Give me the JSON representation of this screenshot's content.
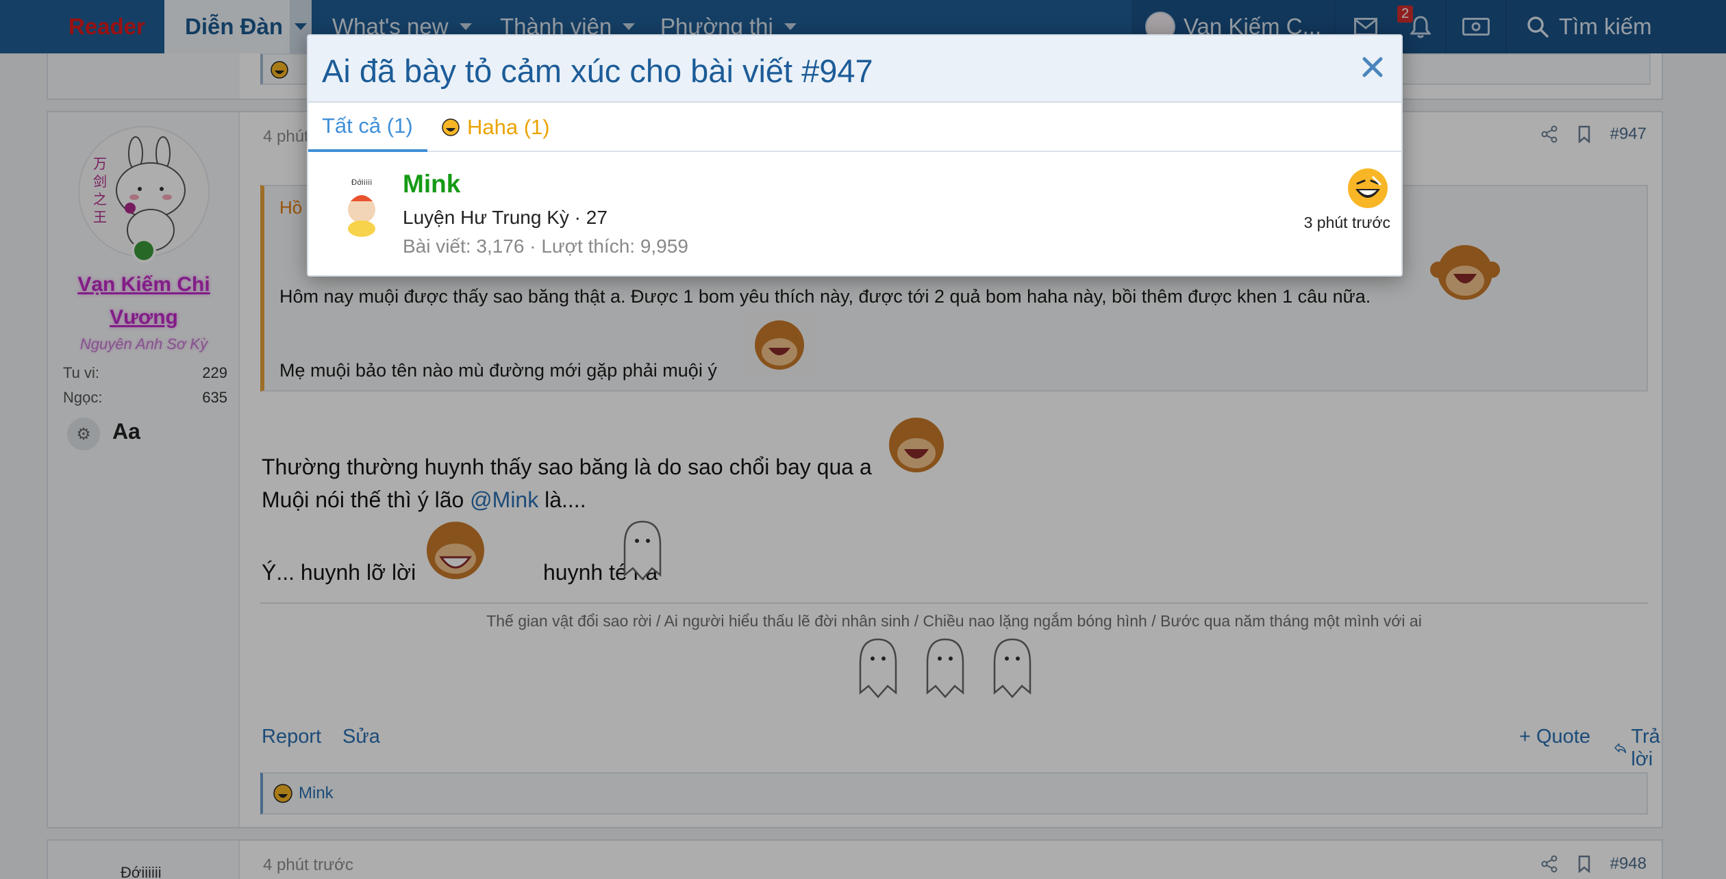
{
  "nav": {
    "reader": "Reader",
    "forum": "Diễn Đàn",
    "whats_new": "What's new",
    "members": "Thành viên",
    "arena": "Phường thị",
    "user_name": "Van Kiếm C...",
    "alerts_count": "2",
    "search_label": "Tìm kiếm"
  },
  "post": {
    "time": "4 phút",
    "number": "#947",
    "author": {
      "name_line1": "Vạn Kiếm Chi",
      "name_line2": "Vương",
      "title": "Nguyên Anh Sơ Kỳ",
      "stats": [
        {
          "label": "Tu vi:",
          "value": "229"
        },
        {
          "label": "Ngọc:",
          "value": "635"
        }
      ],
      "font_toggle": "Aa"
    },
    "quote": {
      "header": "Hồ",
      "line1": "Hôm nay muội được thấy sao băng thật a. Được 1 bom yêu thích này, được tới 2 quả bom haha này, bồi thêm được khen 1 câu nữa.",
      "line2": "Mẹ muội bảo tên nào mù đường mới gặp phải muội ý"
    },
    "body": {
      "line1": "Thường thường huynh thấy sao băng là do sao chổi bay qua a",
      "line2_before": "Muội nói thế thì ý lão",
      "line2_mention": "@Mink",
      "line2_after": "là....",
      "line3_a": "Ý... huynh lỡ lời",
      "line3_b": "huynh té ha"
    },
    "signature": "Thế gian vật đổi sao rời / Ai người hiểu thấu lẽ đời nhân sinh / Chiều nao lặng ngắm bóng hình / Bước qua năm tháng một mình với ai",
    "actions": {
      "report": "Report",
      "edit": "Sửa",
      "quote": "+ Quote",
      "reply": "Trả lời"
    },
    "reactions_bar": "Mink"
  },
  "next_post": {
    "author_label": "Đớiiiiii",
    "time": "4 phút trước",
    "number": "#948"
  },
  "modal": {
    "title": "Ai đã bày tỏ cảm xúc cho bài viết #947",
    "tabs": [
      {
        "label": "Tất cả (1)"
      },
      {
        "label": "Haha (1)"
      }
    ],
    "rows": [
      {
        "avatar_label": "Đớiiiii",
        "name": "Mink",
        "title": "Luyện Hư Trung Kỳ · 27",
        "stats": "Bài viết: 3,176 · Lượt thích: 9,959",
        "time": "3 phút trước",
        "reaction_icon": "haha-emoji-icon"
      }
    ]
  },
  "colors": {
    "nav_bg": "#1f5e95",
    "reader_red": "#e21a1a",
    "link_blue": "#2a6fb2",
    "username_magenta": "#c02bc8",
    "modal_name_green": "#159a15",
    "haha_yellow": "#eba300"
  }
}
